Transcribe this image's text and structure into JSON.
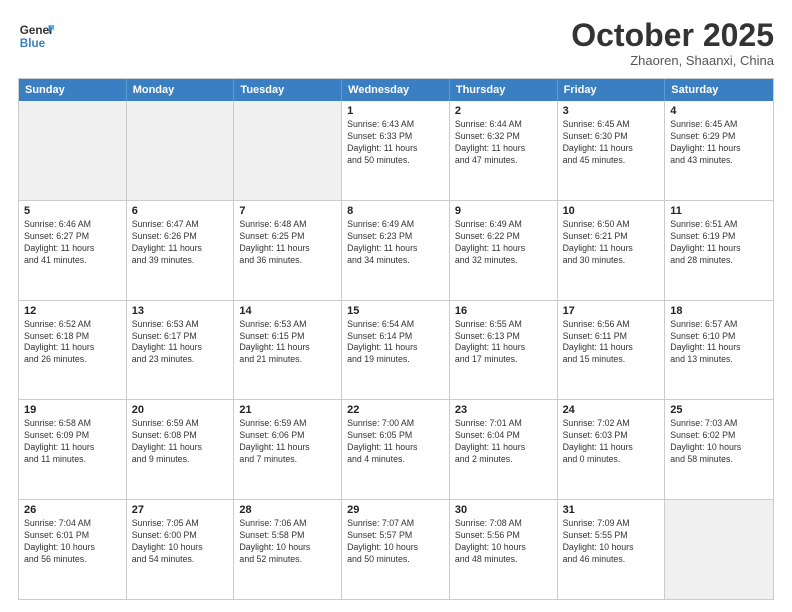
{
  "header": {
    "logo_line1": "General",
    "logo_line2": "Blue",
    "month_title": "October 2025",
    "location": "Zhaoren, Shaanxi, China"
  },
  "weekdays": [
    "Sunday",
    "Monday",
    "Tuesday",
    "Wednesday",
    "Thursday",
    "Friday",
    "Saturday"
  ],
  "rows": [
    [
      {
        "day": "",
        "text": "",
        "shaded": true
      },
      {
        "day": "",
        "text": "",
        "shaded": true
      },
      {
        "day": "",
        "text": "",
        "shaded": true
      },
      {
        "day": "1",
        "text": "Sunrise: 6:43 AM\nSunset: 6:33 PM\nDaylight: 11 hours\nand 50 minutes.",
        "shaded": false
      },
      {
        "day": "2",
        "text": "Sunrise: 6:44 AM\nSunset: 6:32 PM\nDaylight: 11 hours\nand 47 minutes.",
        "shaded": false
      },
      {
        "day": "3",
        "text": "Sunrise: 6:45 AM\nSunset: 6:30 PM\nDaylight: 11 hours\nand 45 minutes.",
        "shaded": false
      },
      {
        "day": "4",
        "text": "Sunrise: 6:45 AM\nSunset: 6:29 PM\nDaylight: 11 hours\nand 43 minutes.",
        "shaded": false
      }
    ],
    [
      {
        "day": "5",
        "text": "Sunrise: 6:46 AM\nSunset: 6:27 PM\nDaylight: 11 hours\nand 41 minutes.",
        "shaded": false
      },
      {
        "day": "6",
        "text": "Sunrise: 6:47 AM\nSunset: 6:26 PM\nDaylight: 11 hours\nand 39 minutes.",
        "shaded": false
      },
      {
        "day": "7",
        "text": "Sunrise: 6:48 AM\nSunset: 6:25 PM\nDaylight: 11 hours\nand 36 minutes.",
        "shaded": false
      },
      {
        "day": "8",
        "text": "Sunrise: 6:49 AM\nSunset: 6:23 PM\nDaylight: 11 hours\nand 34 minutes.",
        "shaded": false
      },
      {
        "day": "9",
        "text": "Sunrise: 6:49 AM\nSunset: 6:22 PM\nDaylight: 11 hours\nand 32 minutes.",
        "shaded": false
      },
      {
        "day": "10",
        "text": "Sunrise: 6:50 AM\nSunset: 6:21 PM\nDaylight: 11 hours\nand 30 minutes.",
        "shaded": false
      },
      {
        "day": "11",
        "text": "Sunrise: 6:51 AM\nSunset: 6:19 PM\nDaylight: 11 hours\nand 28 minutes.",
        "shaded": false
      }
    ],
    [
      {
        "day": "12",
        "text": "Sunrise: 6:52 AM\nSunset: 6:18 PM\nDaylight: 11 hours\nand 26 minutes.",
        "shaded": false
      },
      {
        "day": "13",
        "text": "Sunrise: 6:53 AM\nSunset: 6:17 PM\nDaylight: 11 hours\nand 23 minutes.",
        "shaded": false
      },
      {
        "day": "14",
        "text": "Sunrise: 6:53 AM\nSunset: 6:15 PM\nDaylight: 11 hours\nand 21 minutes.",
        "shaded": false
      },
      {
        "day": "15",
        "text": "Sunrise: 6:54 AM\nSunset: 6:14 PM\nDaylight: 11 hours\nand 19 minutes.",
        "shaded": false
      },
      {
        "day": "16",
        "text": "Sunrise: 6:55 AM\nSunset: 6:13 PM\nDaylight: 11 hours\nand 17 minutes.",
        "shaded": false
      },
      {
        "day": "17",
        "text": "Sunrise: 6:56 AM\nSunset: 6:11 PM\nDaylight: 11 hours\nand 15 minutes.",
        "shaded": false
      },
      {
        "day": "18",
        "text": "Sunrise: 6:57 AM\nSunset: 6:10 PM\nDaylight: 11 hours\nand 13 minutes.",
        "shaded": false
      }
    ],
    [
      {
        "day": "19",
        "text": "Sunrise: 6:58 AM\nSunset: 6:09 PM\nDaylight: 11 hours\nand 11 minutes.",
        "shaded": false
      },
      {
        "day": "20",
        "text": "Sunrise: 6:59 AM\nSunset: 6:08 PM\nDaylight: 11 hours\nand 9 minutes.",
        "shaded": false
      },
      {
        "day": "21",
        "text": "Sunrise: 6:59 AM\nSunset: 6:06 PM\nDaylight: 11 hours\nand 7 minutes.",
        "shaded": false
      },
      {
        "day": "22",
        "text": "Sunrise: 7:00 AM\nSunset: 6:05 PM\nDaylight: 11 hours\nand 4 minutes.",
        "shaded": false
      },
      {
        "day": "23",
        "text": "Sunrise: 7:01 AM\nSunset: 6:04 PM\nDaylight: 11 hours\nand 2 minutes.",
        "shaded": false
      },
      {
        "day": "24",
        "text": "Sunrise: 7:02 AM\nSunset: 6:03 PM\nDaylight: 11 hours\nand 0 minutes.",
        "shaded": false
      },
      {
        "day": "25",
        "text": "Sunrise: 7:03 AM\nSunset: 6:02 PM\nDaylight: 10 hours\nand 58 minutes.",
        "shaded": false
      }
    ],
    [
      {
        "day": "26",
        "text": "Sunrise: 7:04 AM\nSunset: 6:01 PM\nDaylight: 10 hours\nand 56 minutes.",
        "shaded": false
      },
      {
        "day": "27",
        "text": "Sunrise: 7:05 AM\nSunset: 6:00 PM\nDaylight: 10 hours\nand 54 minutes.",
        "shaded": false
      },
      {
        "day": "28",
        "text": "Sunrise: 7:06 AM\nSunset: 5:58 PM\nDaylight: 10 hours\nand 52 minutes.",
        "shaded": false
      },
      {
        "day": "29",
        "text": "Sunrise: 7:07 AM\nSunset: 5:57 PM\nDaylight: 10 hours\nand 50 minutes.",
        "shaded": false
      },
      {
        "day": "30",
        "text": "Sunrise: 7:08 AM\nSunset: 5:56 PM\nDaylight: 10 hours\nand 48 minutes.",
        "shaded": false
      },
      {
        "day": "31",
        "text": "Sunrise: 7:09 AM\nSunset: 5:55 PM\nDaylight: 10 hours\nand 46 minutes.",
        "shaded": false
      },
      {
        "day": "",
        "text": "",
        "shaded": true
      }
    ]
  ]
}
